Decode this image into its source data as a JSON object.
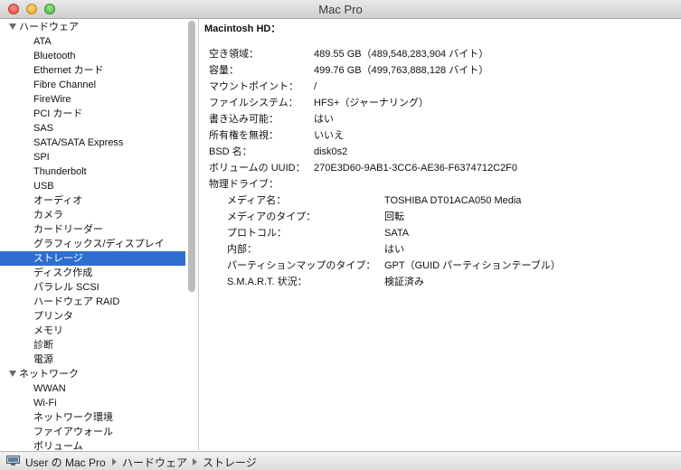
{
  "window": {
    "title": "Mac Pro"
  },
  "sidebar": {
    "hardware_label": "ハードウェア",
    "hardware_items": [
      "ATA",
      "Bluetooth",
      "Ethernet カード",
      "Fibre Channel",
      "FireWire",
      "PCI カード",
      "SAS",
      "SATA/SATA Express",
      "SPI",
      "Thunderbolt",
      "USB",
      "オーディオ",
      "カメラ",
      "カードリーダー",
      "グラフィックス/ディスプレイ",
      "ストレージ",
      "ディスク作成",
      "パラレル SCSI",
      "ハードウェア RAID",
      "プリンタ",
      "メモリ",
      "診断",
      "電源"
    ],
    "selected_item": "ストレージ",
    "network_label": "ネットワーク",
    "network_items": [
      "WWAN",
      "Wi-Fi",
      "ネットワーク環境",
      "ファイアウォール",
      "ボリューム"
    ]
  },
  "detail": {
    "volume_title": "Macintosh HD：",
    "rows": [
      {
        "label": "空き領域：",
        "value": "489.55 GB（489,548,283,904 バイト）"
      },
      {
        "label": "容量：",
        "value": "499.76 GB（499,763,888,128 バイト）"
      },
      {
        "label": "マウントポイント：",
        "value": "/"
      },
      {
        "label": "ファイルシステム：",
        "value": "HFS+（ジャーナリング）"
      },
      {
        "label": "書き込み可能：",
        "value": "はい"
      },
      {
        "label": "所有権を無視：",
        "value": "いいえ"
      },
      {
        "label": "BSD 名：",
        "value": "disk0s2"
      },
      {
        "label": "ボリュームの UUID：",
        "value": "270E3D60-9AB1-3CC6-AE36-F6374712C2F0"
      }
    ],
    "physical_drive_label": "物理ドライブ：",
    "physical_rows": [
      {
        "label": "メディア名：",
        "value": "TOSHIBA DT01ACA050 Media"
      },
      {
        "label": "メディアのタイプ：",
        "value": "回転"
      },
      {
        "label": "プロトコル：",
        "value": "SATA"
      },
      {
        "label": "内部：",
        "value": "はい"
      },
      {
        "label": "パーティションマップのタイプ：",
        "value": "GPT（GUID パーティションテーブル）"
      },
      {
        "label": "S.M.A.R.T. 状況：",
        "value": "検証済み"
      }
    ]
  },
  "pathbar": {
    "icon": "computer-icon",
    "crumbs": [
      "User の Mac Pro",
      "ハードウェア",
      "ストレージ"
    ]
  }
}
